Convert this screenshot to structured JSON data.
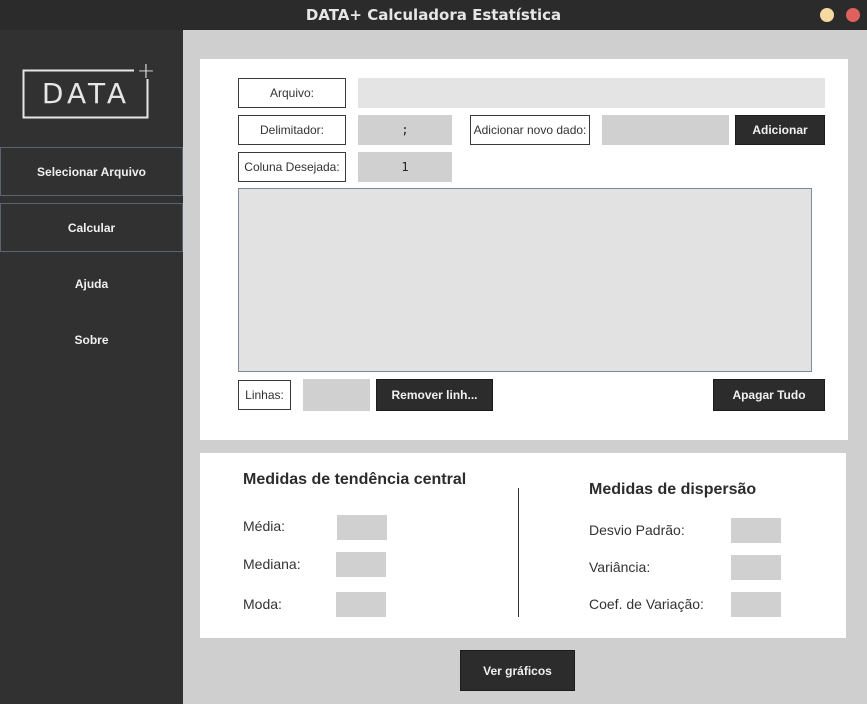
{
  "window": {
    "title": "DATA+ Calculadora Estatística"
  },
  "logo": {
    "text": "DATA",
    "plus": "+"
  },
  "sidebar": {
    "items": [
      {
        "label": "Selecionar Arquivo"
      },
      {
        "label": "Calcular"
      },
      {
        "label": "Ajuda"
      },
      {
        "label": "Sobre"
      }
    ]
  },
  "form": {
    "file_label": "Arquivo:",
    "file_value": "",
    "delimiter_label": "Delimitador:",
    "delimiter_value": ";",
    "new_data_label": "Adicionar novo dado:",
    "new_data_value": "",
    "add_button": "Adicionar",
    "column_label": "Coluna Desejada:",
    "column_value": "1",
    "data_text": "",
    "lines_label": "Linhas:",
    "lines_value": "",
    "remove_button": "Remover linh...",
    "clear_button": "Apagar Tudo"
  },
  "central": {
    "title": "Medidas de tendência central",
    "mean_label": "Média:",
    "mean_value": "",
    "median_label": "Mediana:",
    "median_value": "",
    "mode_label": "Moda:",
    "mode_value": ""
  },
  "dispersion": {
    "title": "Medidas de dispersão",
    "stddev_label": "Desvio Padrão:",
    "stddev_value": "",
    "variance_label": "Variância:",
    "variance_value": "",
    "cv_label": "Coef. de Variação:",
    "cv_value": ""
  },
  "charts_button": "Ver gráficos",
  "colors": {
    "sidebar": "#313131",
    "titlebar": "#2b2b2b",
    "button_dark": "#2c2c2c",
    "field_gray": "#d0d0d0",
    "background": "#cfcfcf"
  }
}
